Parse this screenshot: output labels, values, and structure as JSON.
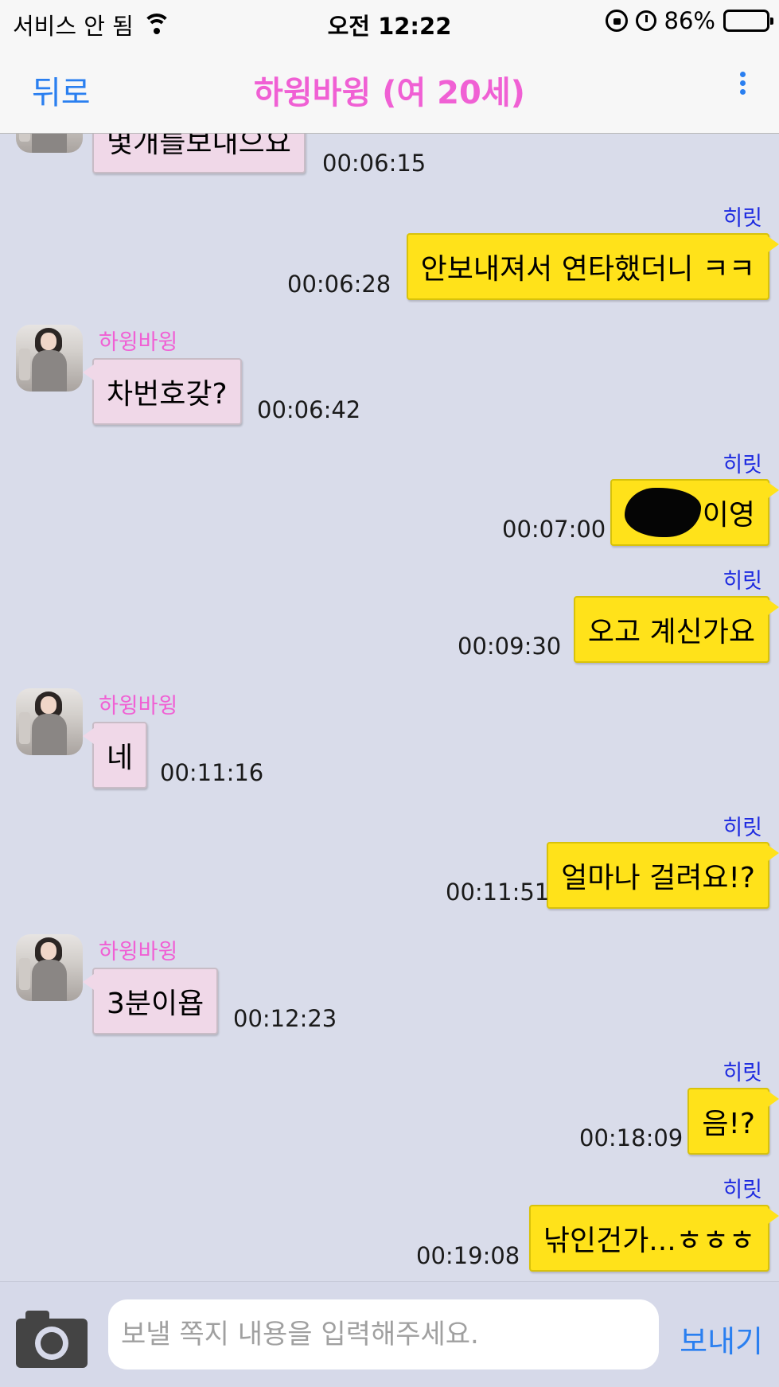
{
  "status_bar": {
    "carrier": "서비스 안 됨",
    "time": "오전 12:22",
    "battery": "86%"
  },
  "nav": {
    "back_label": "뒤로",
    "title": "하윙바윙 (여 20세)"
  },
  "messages": [
    {
      "dir": "in",
      "sender": "",
      "text": "몇개를보내으요",
      "time": "00:06:15"
    },
    {
      "dir": "out",
      "sender": "히릿",
      "text": "안보내져서 연타했더니 ㅋㅋ",
      "time": "00:06:28"
    },
    {
      "dir": "in",
      "sender": "하윙바윙",
      "text": "차번호갖?",
      "time": "00:06:42"
    },
    {
      "dir": "out",
      "sender": "히릿",
      "text": "이영",
      "time": "00:07:00",
      "redacted": true
    },
    {
      "dir": "out",
      "sender": "히릿",
      "text": "오고 계신가요",
      "time": "00:09:30"
    },
    {
      "dir": "in",
      "sender": "하윙바윙",
      "text": "네",
      "time": "00:11:16"
    },
    {
      "dir": "out",
      "sender": "히릿",
      "text": "얼마나 걸려요!?",
      "time": "00:11:51"
    },
    {
      "dir": "in",
      "sender": "하윙바윙",
      "text": "3분이욥",
      "time": "00:12:23"
    },
    {
      "dir": "out",
      "sender": "히릿",
      "text": "음!?",
      "time": "00:18:09"
    },
    {
      "dir": "out",
      "sender": "히릿",
      "text": "낚인건가...ㅎㅎㅎ",
      "time": "00:19:08"
    }
  ],
  "composer": {
    "placeholder": "보낼 쪽지 내용을 입력해주세요.",
    "value": "",
    "send_label": "보내기"
  },
  "colors": {
    "accent": "#2a7ff0",
    "title_pink": "#f060d4",
    "outgoing_bubble": "#ffe21a",
    "incoming_bubble": "#f0d8e8",
    "chat_background": "#d9dcea",
    "sender_blue": "#1d2ae0"
  },
  "icons": {
    "wifi": "wifi-icon",
    "rotation_lock": "rotation-lock-icon",
    "alarm": "alarm-icon",
    "battery": "battery-icon",
    "more": "more-vertical-icon",
    "camera": "camera-icon"
  }
}
